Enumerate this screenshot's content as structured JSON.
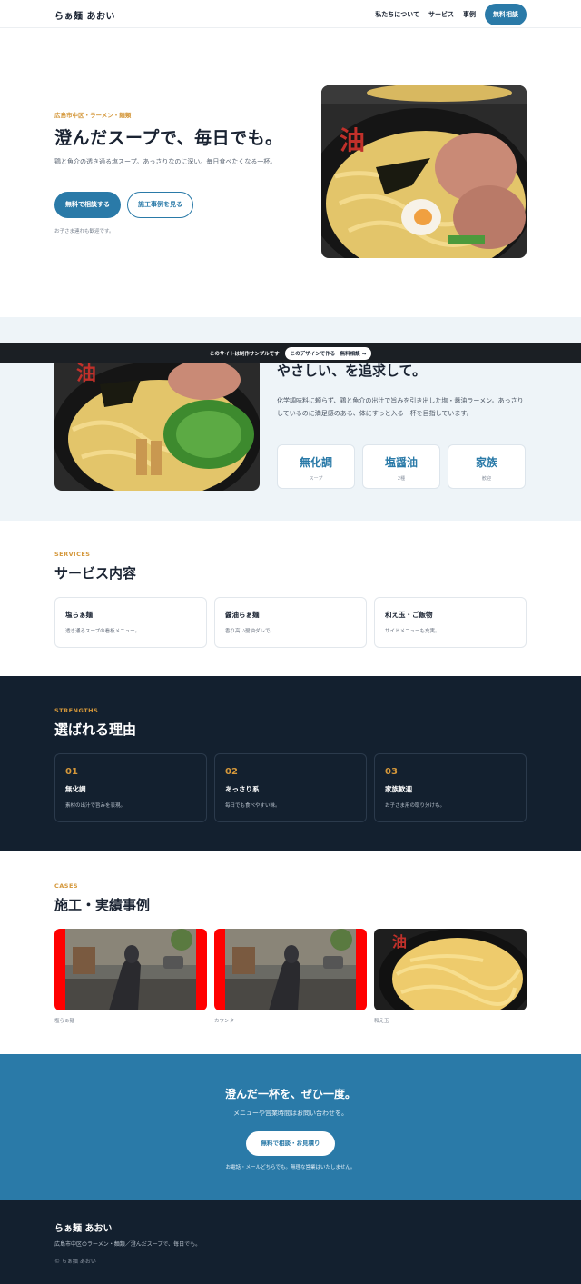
{
  "header": {
    "logo": "らぁ麺 あおい",
    "nav": [
      "私たちについて",
      "サービス",
      "事例"
    ],
    "cta": "無料相談"
  },
  "hero": {
    "kicker": "広島市中区・ラーメン・麺類",
    "title": "澄んだスープで、毎日でも。",
    "desc": "鶏と魚介の透き通る塩スープ。あっさりなのに深い。毎日食べたくなる一杯。",
    "btn_primary": "無料で相談する",
    "btn_secondary": "施工事例を見る",
    "note": "お子さま連れも歓迎です。"
  },
  "banner": {
    "text": "このサイトは制作サンプルです",
    "btn": "このデザインで作る　無料相談 →"
  },
  "about": {
    "title": "やさしい、を追求して。",
    "desc": "化学調味料に頼らず、鶏と魚介の出汁で旨みを引き出した塩・醤油ラーメン。あっさりしているのに満足感のある、体にすっと入る一杯を目指しています。",
    "stats": [
      {
        "value": "無化調",
        "label": "スープ"
      },
      {
        "value": "塩醤油",
        "label": "2種"
      },
      {
        "value": "家族",
        "label": "歓迎"
      }
    ]
  },
  "services": {
    "kicker": "SERVICES",
    "title": "サービス内容",
    "items": [
      {
        "name": "塩らぁ麺",
        "desc": "透き通るスープの看板メニュー。"
      },
      {
        "name": "醤油らぁ麺",
        "desc": "香り高い醤油ダレで。"
      },
      {
        "name": "和え玉・ご飯物",
        "desc": "サイドメニューも充実。"
      }
    ]
  },
  "strengths": {
    "kicker": "STRENGTHS",
    "title": "選ばれる理由",
    "items": [
      {
        "num": "01",
        "name": "無化調",
        "desc": "素材の出汁で旨みを表現。"
      },
      {
        "num": "02",
        "name": "あっさり系",
        "desc": "毎日でも食べやすい味。"
      },
      {
        "num": "03",
        "name": "家族歓迎",
        "desc": "お子さま用の取り分けも。"
      }
    ]
  },
  "cases": {
    "kicker": "CASES",
    "title": "施工・実績事例",
    "items": [
      {
        "label": "塩らぁ麺"
      },
      {
        "label": "カウンター"
      },
      {
        "label": "和え玉"
      }
    ]
  },
  "cta": {
    "title": "澄んだ一杯を、ぜひ一度。",
    "sub": "メニューや営業時間はお問い合わせを。",
    "btn": "無料で相談・お見積り",
    "note": "お電話・メールどちらでも。無理な営業はいたしません。"
  },
  "footer": {
    "logo": "らぁ麺 あおい",
    "desc": "広島市中区のラーメン・麺類／澄んだスープで、毎日でも。",
    "copy": "© らぁ麺 あおい"
  },
  "colors": {
    "accent": "#2a7aa8",
    "kicker": "#d4973a",
    "dark": "#13202f"
  }
}
